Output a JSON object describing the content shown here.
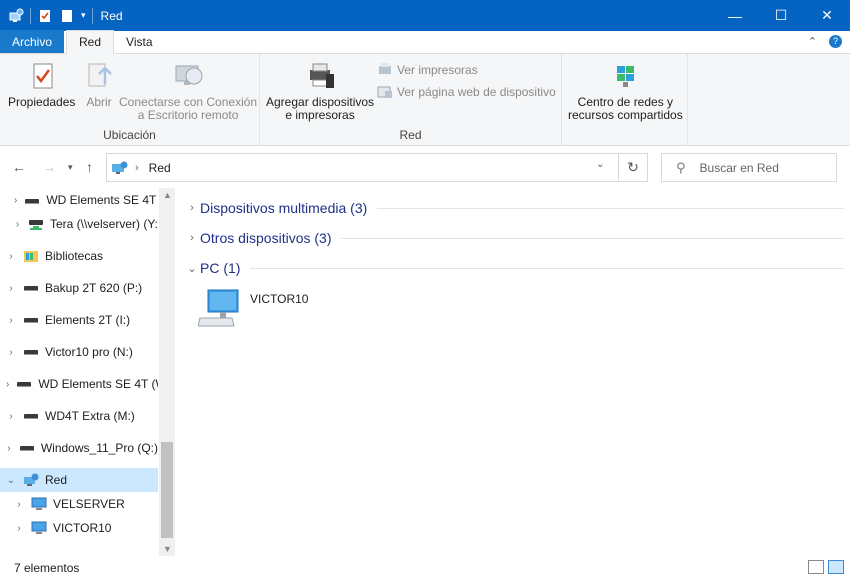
{
  "window": {
    "title": "Red",
    "controls": {
      "minimize": "—",
      "maximize": "☐",
      "close": "✕"
    }
  },
  "tabs": {
    "file": "Archivo",
    "red": "Red",
    "vista": "Vista"
  },
  "ribbon": {
    "ubicacion": {
      "label": "Ubicación",
      "propiedades": "Propiedades",
      "abrir": "Abrir",
      "conectar_line1": "Conectarse con Conexión",
      "conectar_line2": "a Escritorio remoto"
    },
    "red": {
      "label": "Red",
      "agregar_line1": "Agregar dispositivos",
      "agregar_line2": "e impresoras",
      "ver_impresoras": "Ver impresoras",
      "ver_pagina": "Ver página web de dispositivo"
    },
    "centro_line1": "Centro de redes y",
    "centro_line2": "recursos compartidos"
  },
  "address": {
    "path": "Red",
    "search_placeholder": "Buscar en Red"
  },
  "nav": {
    "items": [
      {
        "label": "WD Elements SE 4T (",
        "type": "drive"
      },
      {
        "label": "Tera (\\\\velserver) (Y:",
        "type": "netdrive"
      },
      {
        "label": "Bibliotecas",
        "type": "library"
      },
      {
        "label": "Bakup 2T 620 (P:)",
        "type": "drive"
      },
      {
        "label": "Elements 2T (I:)",
        "type": "drive"
      },
      {
        "label": "Victor10 pro (N:)",
        "type": "drive"
      },
      {
        "label": "WD Elements SE 4T (W",
        "type": "drive"
      },
      {
        "label": "WD4T Extra (M:)",
        "type": "drive"
      },
      {
        "label": "Windows_11_Pro (Q:)",
        "type": "drive"
      },
      {
        "label": "Red",
        "type": "network"
      },
      {
        "label": "VELSERVER",
        "type": "computer"
      },
      {
        "label": "VICTOR10",
        "type": "computer"
      }
    ]
  },
  "content": {
    "groups": [
      {
        "name": "Dispositivos multimedia (3)",
        "expanded": false
      },
      {
        "name": "Otros dispositivos (3)",
        "expanded": false
      },
      {
        "name": "PC (1)",
        "expanded": true
      }
    ],
    "pc_items": [
      {
        "label": "VICTOR10",
        "icon": "desktop-computer-icon"
      }
    ]
  },
  "status": {
    "count": "7 elementos"
  },
  "colors": {
    "titlebar": "#0563c1",
    "file_tab": "#1979ca",
    "selected": "#cce8ff",
    "group_header": "#1e3287"
  }
}
